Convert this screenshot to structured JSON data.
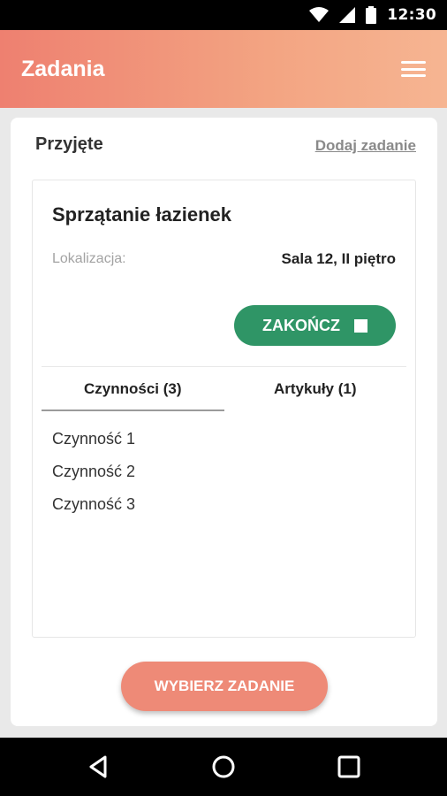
{
  "status_bar": {
    "time": "12:30"
  },
  "app_bar": {
    "title": "Zadania"
  },
  "section": {
    "title": "Przyjęte",
    "add_link": "Dodaj zadanie"
  },
  "task": {
    "title": "Sprzątanie łazienek",
    "location_label": "Lokalizacja:",
    "location_value": "Sala 12, II piętro",
    "finish_button": "ZAKOŃCZ"
  },
  "tabs": [
    {
      "label": "Czynności (3)",
      "active": true
    },
    {
      "label": "Artykuły (1)",
      "active": false
    }
  ],
  "activities": [
    "Czynność 1",
    "Czynność 2",
    "Czynność 3"
  ],
  "footer": {
    "pick_button": "WYBIERZ ZADANIE"
  },
  "colors": {
    "header_start": "#ee8070",
    "header_end": "#f6b592",
    "finish_green": "#2f9566",
    "pick_salmon": "#ee8a77"
  },
  "icons": [
    "wifi-icon",
    "signal-icon",
    "battery-icon",
    "hamburger-menu-icon",
    "stop-square-icon",
    "back-icon",
    "home-icon",
    "recents-icon"
  ]
}
